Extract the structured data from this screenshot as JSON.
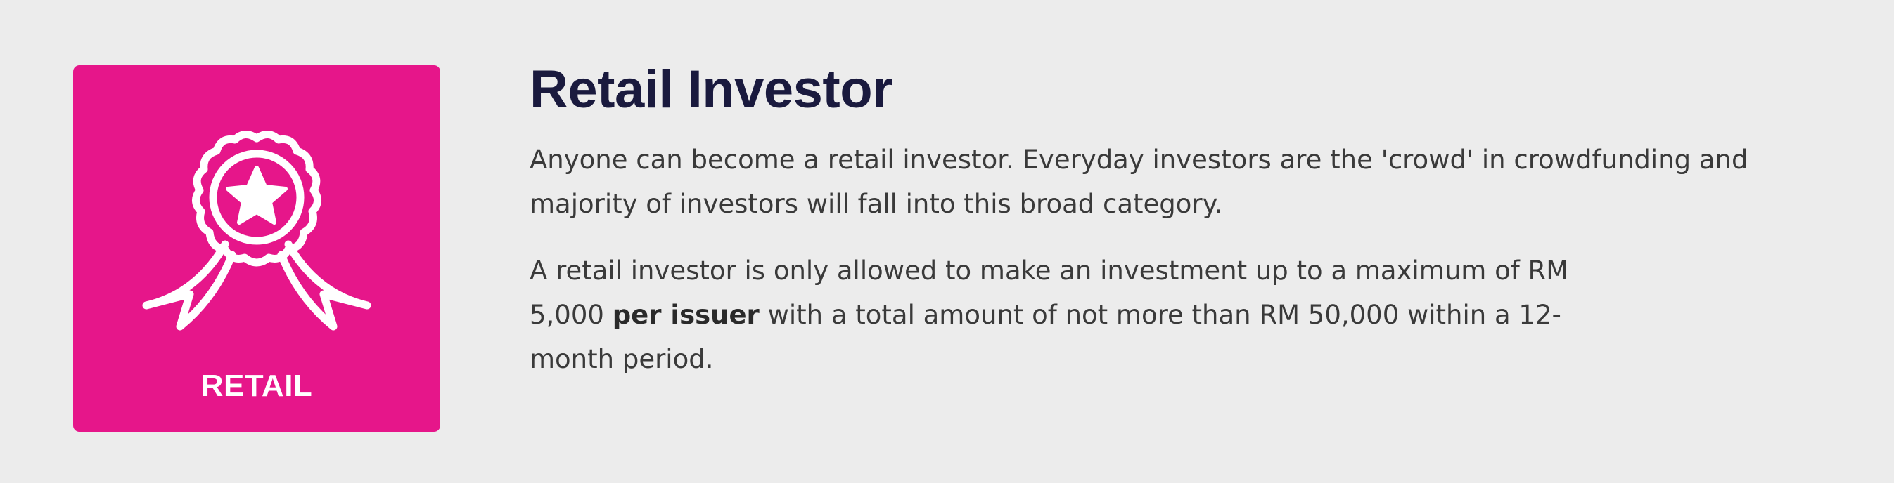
{
  "card": {
    "icon": "award-ribbon-star-icon",
    "label": "RETAIL",
    "color": "#e6168a"
  },
  "title": "Retail Investor",
  "paragraph1": "Anyone can become a retail investor. Everyday investors are the 'crowd' in crowdfunding and majority of investors will fall into this broad category.",
  "paragraph2": {
    "part1": "A retail investor is only allowed to make an investment up to a maximum of RM 5,000 ",
    "bold": "per issuer",
    "part2": " with a total amount of not more than RM 50,000 within a 12-month period."
  },
  "colors": {
    "background": "#ececec",
    "title": "#1a1a3e",
    "body_text": "#3a3a3a"
  }
}
